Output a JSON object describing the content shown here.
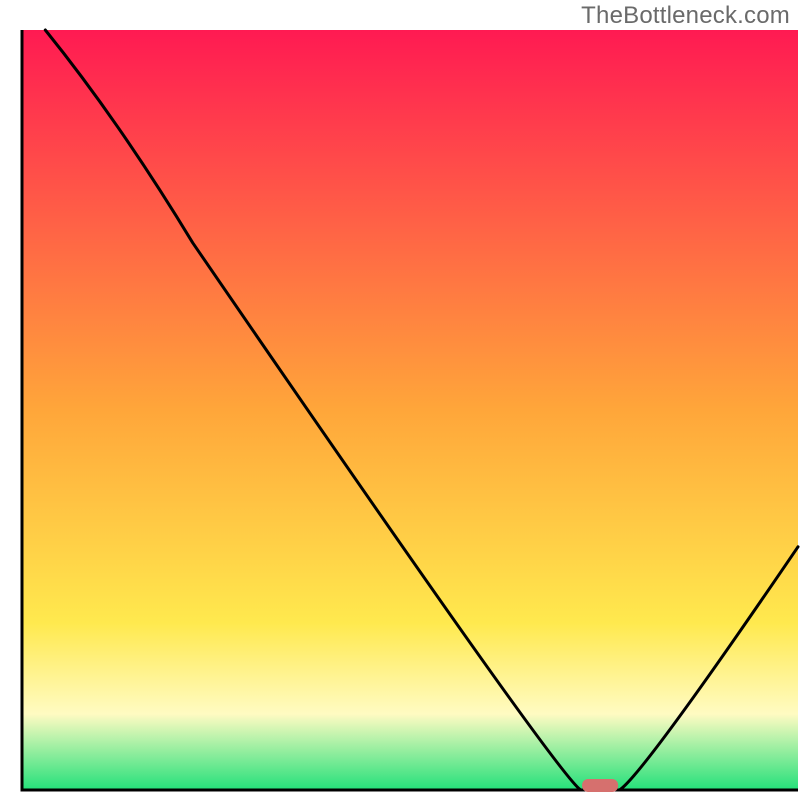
{
  "watermark": "TheBottleneck.com",
  "chart_data": {
    "type": "line",
    "title": "",
    "xlabel": "",
    "ylabel": "",
    "xlim": [
      0,
      100
    ],
    "ylim": [
      0,
      100
    ],
    "x": [
      3,
      22,
      72,
      77,
      100
    ],
    "values": [
      100,
      72,
      0,
      0,
      32
    ],
    "marker": {
      "x": 74.5,
      "y": 0
    },
    "background": {
      "type": "vertical-gradient",
      "stops": [
        {
          "pos": 0,
          "color": "#ff1a52"
        },
        {
          "pos": 50,
          "color": "#ffa63a"
        },
        {
          "pos": 78,
          "color": "#ffe94e"
        },
        {
          "pos": 90,
          "color": "#fffbc2"
        },
        {
          "pos": 100,
          "color": "#24e07a"
        }
      ]
    }
  }
}
